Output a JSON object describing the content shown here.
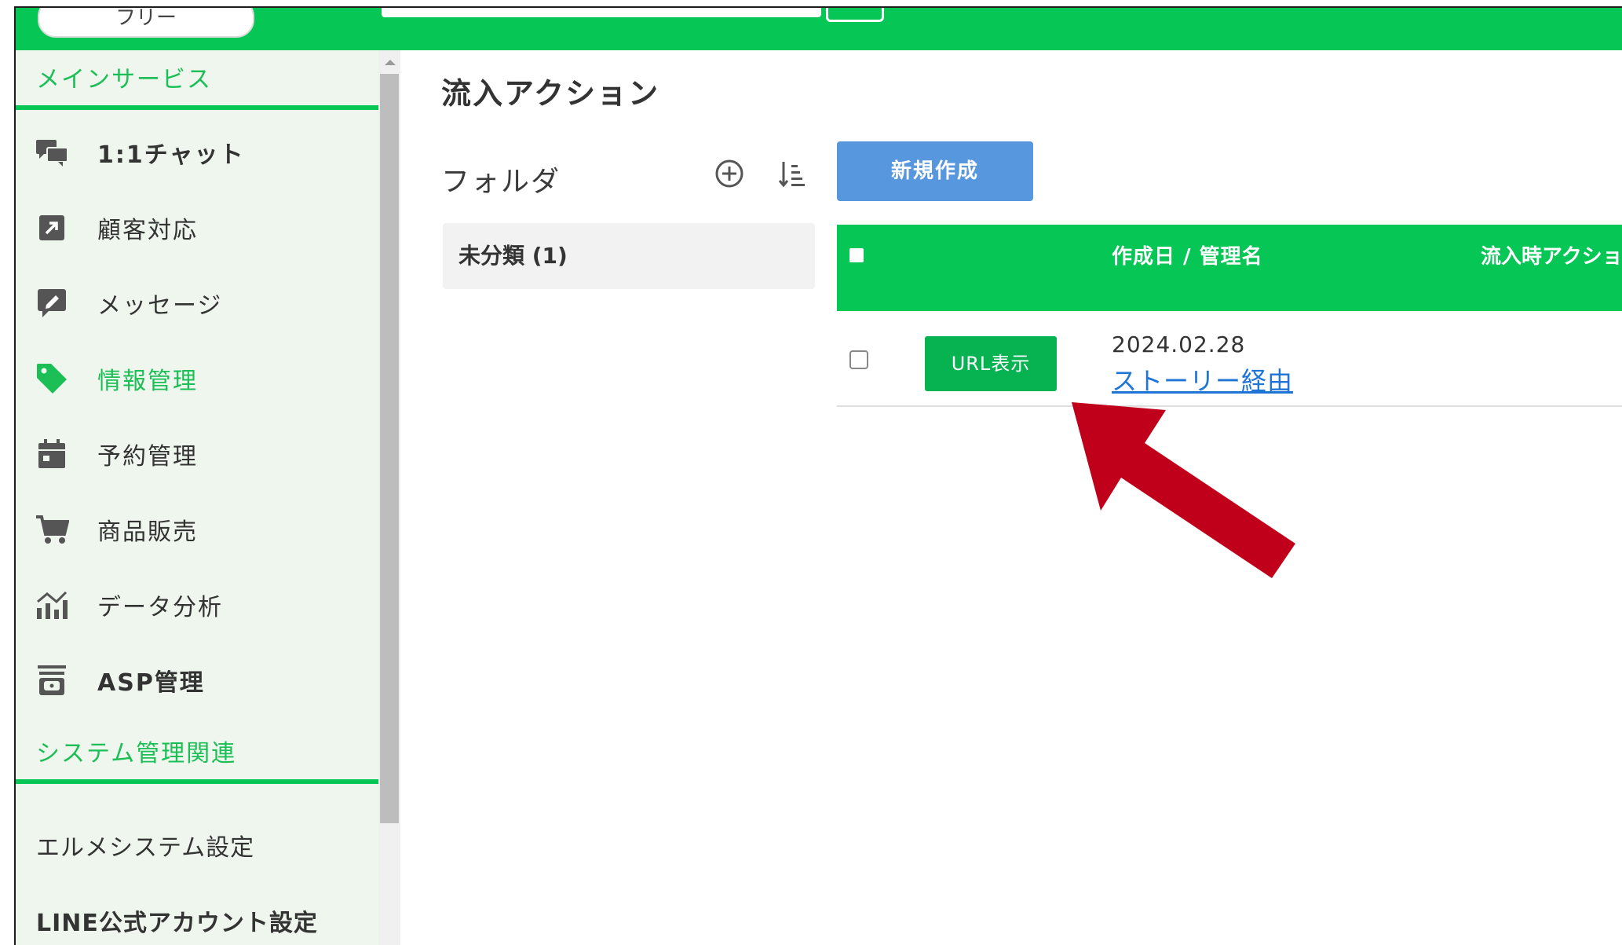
{
  "topbar": {
    "plan_label": "フリー"
  },
  "sidebar": {
    "section_main": "メインサービス",
    "items": [
      {
        "label": "1:1チャット",
        "icon": "chat-bubbles-icon"
      },
      {
        "label": "顧客対応",
        "icon": "external-link-icon"
      },
      {
        "label": "メッセージ",
        "icon": "edit-message-icon"
      },
      {
        "label": "情報管理",
        "icon": "tag-icon",
        "active": true
      },
      {
        "label": "予約管理",
        "icon": "calendar-icon"
      },
      {
        "label": "商品販売",
        "icon": "cart-icon"
      },
      {
        "label": "データ分析",
        "icon": "bar-chart-icon"
      },
      {
        "label": "ASP管理",
        "icon": "archive-box-icon"
      }
    ],
    "section_system": "システム管理関連",
    "system_items": [
      {
        "label": "エルメシステム設定"
      },
      {
        "label": "LINE公式アカウント設定"
      }
    ]
  },
  "main": {
    "page_title": "流入アクション",
    "folder_title": "フォルダ",
    "folders": [
      {
        "label": "未分類 (1)"
      }
    ],
    "new_button": "新規作成",
    "table": {
      "columns": [
        "作成日 / 管理名",
        "流入時アクショ"
      ],
      "rows": [
        {
          "button": "URL表示",
          "date": "2024.02.28",
          "name": "ストーリー経由"
        }
      ]
    }
  },
  "colors": {
    "brand_green": "#06c755",
    "sidebar_bg": "#eef6ee",
    "new_button_blue": "#5797de",
    "link_blue": "#1f75d6",
    "annotation_arrow": "#c0001a"
  }
}
